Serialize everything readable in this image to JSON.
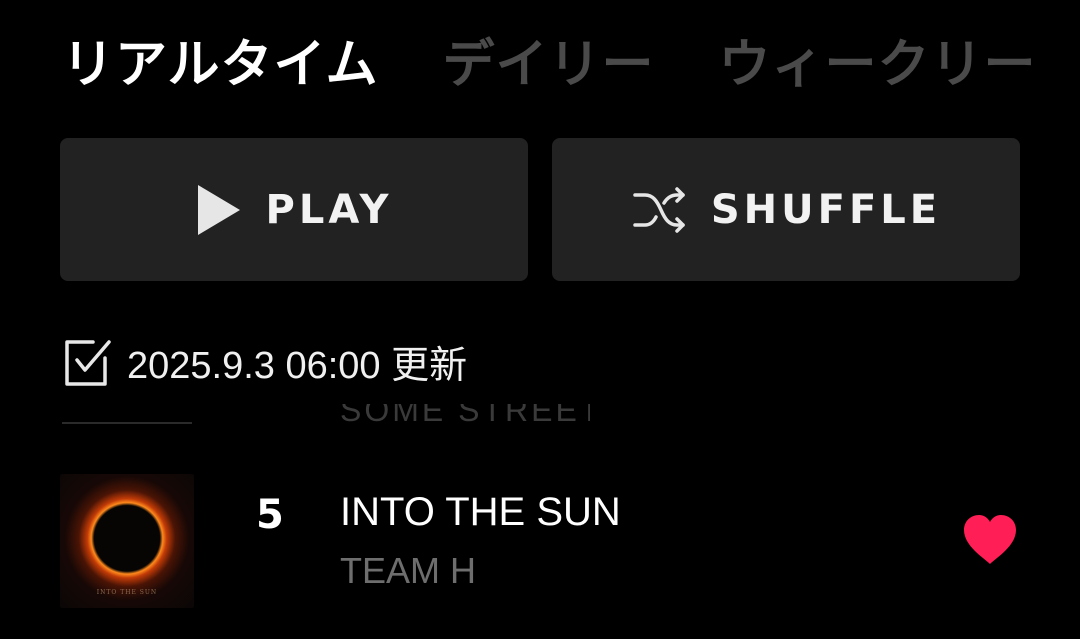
{
  "tabs": [
    {
      "label": "リアルタイム",
      "active": true
    },
    {
      "label": "デイリー",
      "active": false
    },
    {
      "label": "ウィークリー",
      "active": false
    }
  ],
  "actions": {
    "play_label": "PLAY",
    "shuffle_label": "SHUFFLE"
  },
  "update": {
    "text": "2025.9.3 06:00 更新"
  },
  "partial_row": {
    "text": "SOME STREET"
  },
  "track": {
    "rank": "5",
    "title": "INTO THE SUN",
    "artist": "TEAM H",
    "cover_caption": "INTO THE SUN",
    "liked": true
  },
  "colors": {
    "background": "#000000",
    "button_bg": "#222222",
    "inactive_tab": "#4a4a4a",
    "heart": "#ff1e56",
    "artist_text": "#6e6e6e"
  }
}
